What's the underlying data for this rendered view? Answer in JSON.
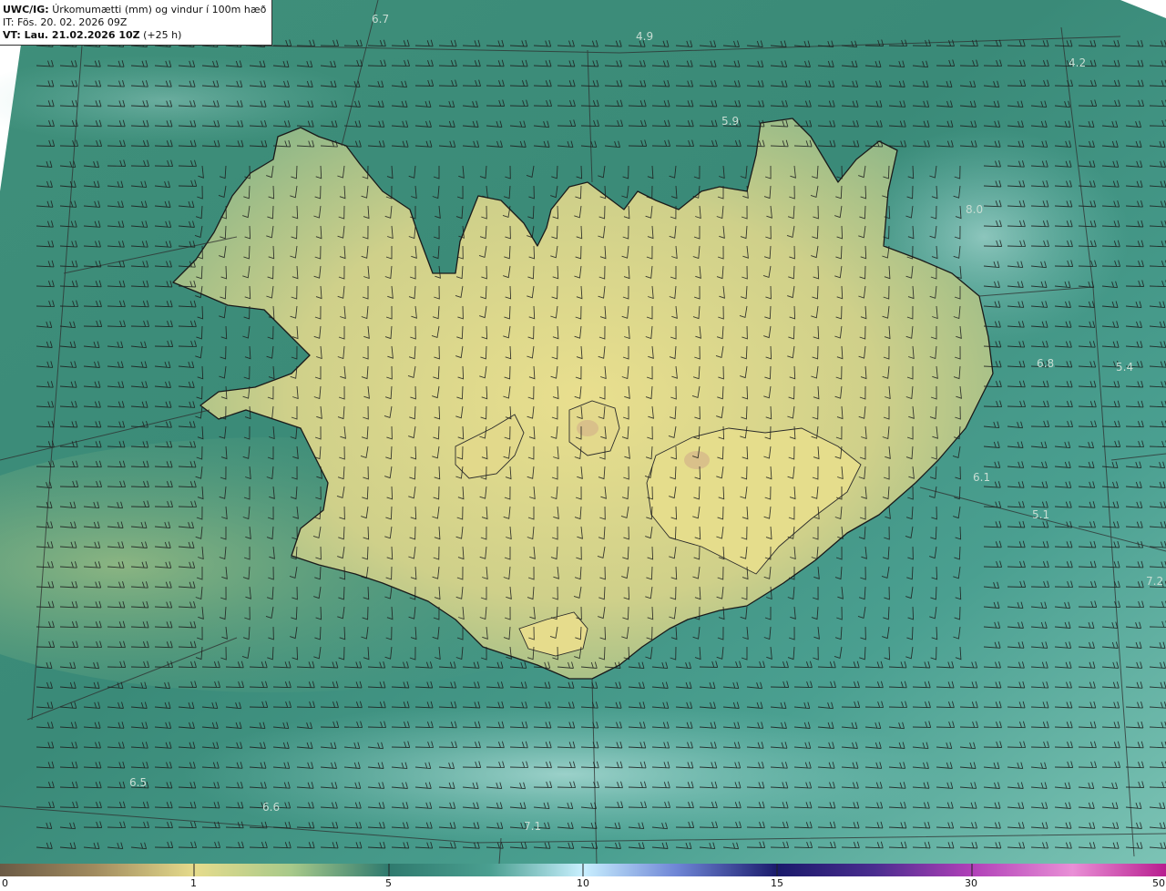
{
  "header": {
    "product": "UWC/IG:",
    "title": "Úrkomumætti (mm) og vindur í 100m hæð",
    "it_line": "IT: Fös. 20. 02. 2026 09Z",
    "vt_prefix": "VT: Lau. 21.02.2026 10Z",
    "vt_suffix": "(+25 h)"
  },
  "colorbar": {
    "ticks": [
      {
        "label": "0",
        "value": 0
      },
      {
        "label": "1",
        "value": 1
      },
      {
        "label": "5",
        "value": 5
      },
      {
        "label": "10",
        "value": 10
      },
      {
        "label": "15",
        "value": 15
      },
      {
        "label": "30",
        "value": 30
      },
      {
        "label": "50",
        "value": 50
      }
    ],
    "colors": [
      "#6b5a45",
      "#c9b27a",
      "#e8df8c",
      "#5fa68a",
      "#2f7a6e",
      "#7ec9bd",
      "#c9f0ff",
      "#2f3fa8",
      "#1a1a6b",
      "#7b1f9a",
      "#d14fc7",
      "#f0b6e6"
    ]
  },
  "value_labels": [
    "6.7",
    "4.9",
    "4.2",
    "5.9",
    "8.0",
    "6.8",
    "5.4",
    "6.1",
    "5.1",
    "7.2",
    "6.5",
    "6.6",
    "7.1"
  ]
}
